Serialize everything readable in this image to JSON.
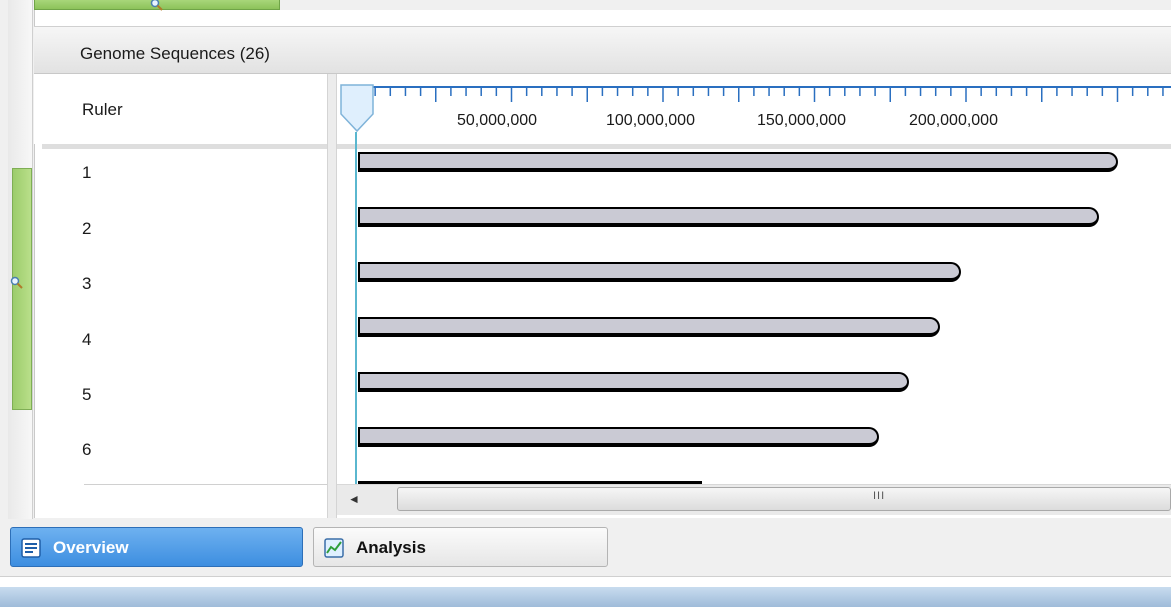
{
  "panel": {
    "title": "Genome Sequences (26)"
  },
  "ruler": {
    "label": "Ruler",
    "tick_labels": [
      "50,000,000",
      "100,000,000",
      "150,000,000",
      "200,000,000"
    ]
  },
  "sequences": [
    {
      "label": "1"
    },
    {
      "label": "2"
    },
    {
      "label": "3"
    },
    {
      "label": "4"
    },
    {
      "label": "5"
    },
    {
      "label": "6"
    }
  ],
  "scrollbar": {
    "grip": "III",
    "left_arrow": "◄"
  },
  "tabs": [
    {
      "label": "Overview",
      "icon": "overview-list-icon",
      "active": true
    },
    {
      "label": "Analysis",
      "icon": "analysis-chart-icon",
      "active": false
    }
  ],
  "colors": {
    "bar_fill": "#cacad4",
    "position_line": "#5ab7cf",
    "zoom_thumb": "#9ccc6b",
    "active_tab": "#3d8ee0"
  }
}
